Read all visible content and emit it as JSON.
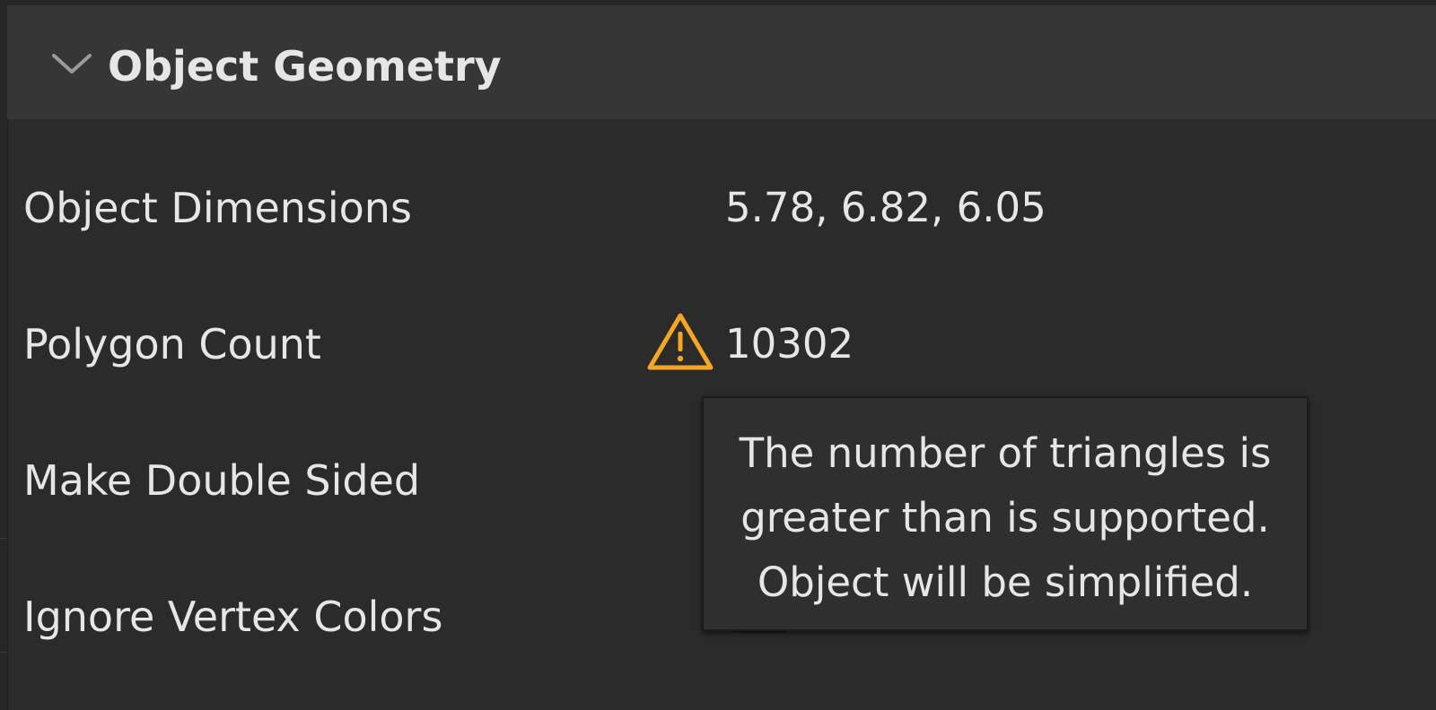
{
  "section": {
    "title": "Object Geometry",
    "expanded": true,
    "toggle_icon": "chevron-down-icon"
  },
  "rows": {
    "object_dimensions": {
      "label": "Object Dimensions",
      "value": "5.78, 6.82, 6.05"
    },
    "polygon_count": {
      "label": "Polygon Count",
      "value": "10302",
      "warning_icon": "warning-triangle-icon"
    },
    "make_double_sided": {
      "label": "Make Double Sided"
    },
    "ignore_vertex_colors": {
      "label": "Ignore Vertex Colors"
    }
  },
  "tooltip": {
    "lines": [
      "The number of triangles is",
      "greater than is supported.",
      "Object will be simplified."
    ]
  },
  "colors": {
    "background": "#2b2b2b",
    "header_background": "#363636",
    "text": "#e6e6e6",
    "warning": "#f5a623",
    "tooltip_background": "#2f2f2f"
  }
}
